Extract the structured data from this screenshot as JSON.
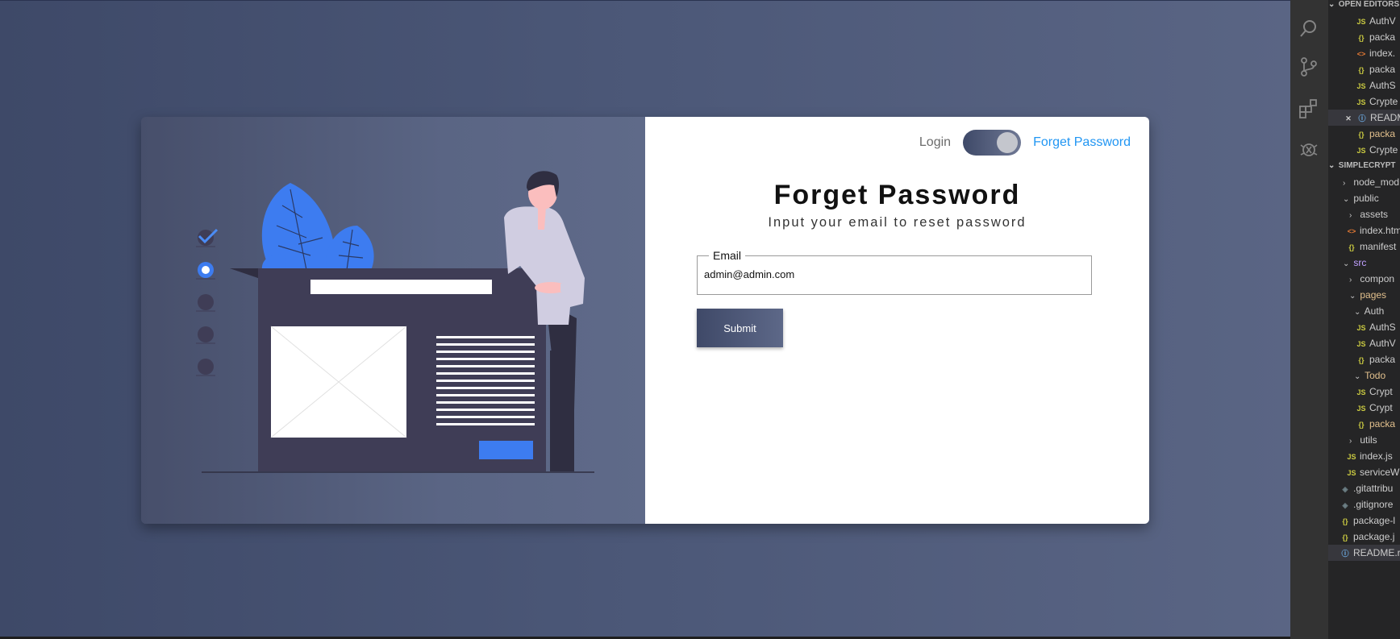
{
  "auth": {
    "toggle": {
      "left_label": "Login",
      "right_label": "Forget Password",
      "state": "forget"
    },
    "title": "Forget Password",
    "subtitle": "Input your email to reset password",
    "email": {
      "legend": "Email",
      "value": "admin@admin.com"
    },
    "submit_label": "Submit"
  },
  "colors": {
    "accent": "#2196f3",
    "illustration_blue": "#3d7cf0",
    "dark_slate": "#3f3d56",
    "page_bg": "#4c5878"
  },
  "vscode": {
    "activity_icons": [
      "search-icon",
      "source-control-icon",
      "extensions-icon",
      "debug-icon"
    ],
    "explorer": {
      "open_editors_header": "OPEN EDITORS",
      "open_editors": [
        {
          "icon": "JS",
          "name": "AuthV"
        },
        {
          "icon": "{}",
          "name": "packa"
        },
        {
          "icon": "<>",
          "name": "index."
        },
        {
          "icon": "{}",
          "name": "packa"
        },
        {
          "icon": "JS",
          "name": "AuthS"
        },
        {
          "icon": "JS",
          "name": "Crypte"
        },
        {
          "icon": "i",
          "name": "READM"
        },
        {
          "icon": "{}",
          "name": "packa"
        },
        {
          "icon": "JS",
          "name": "Crypte"
        }
      ],
      "project_header": "SIMPLECRYPT",
      "tree": [
        {
          "label": "node_mod",
          "type": "folder"
        },
        {
          "label": "public",
          "type": "folder"
        },
        {
          "label": "assets",
          "type": "folder"
        },
        {
          "label": "index.htm",
          "type": "html"
        },
        {
          "label": "manifest",
          "type": "json"
        },
        {
          "label": "src",
          "type": "folder"
        },
        {
          "label": "compon",
          "type": "folder"
        },
        {
          "label": "pages",
          "type": "folder"
        },
        {
          "label": "Auth",
          "type": "folder"
        },
        {
          "label": "AuthS",
          "type": "js"
        },
        {
          "label": "AuthV",
          "type": "js"
        },
        {
          "label": "packa",
          "type": "json"
        },
        {
          "label": "Todo",
          "type": "folder"
        },
        {
          "label": "Crypt",
          "type": "js"
        },
        {
          "label": "Crypt",
          "type": "js"
        },
        {
          "label": "packa",
          "type": "json"
        },
        {
          "label": "utils",
          "type": "folder"
        },
        {
          "label": "index.js",
          "type": "js"
        },
        {
          "label": "serviceW",
          "type": "js"
        },
        {
          "label": ".gitattribu",
          "type": "git"
        },
        {
          "label": ".gitignore",
          "type": "git"
        },
        {
          "label": "package-l",
          "type": "json"
        },
        {
          "label": "package.j",
          "type": "json"
        },
        {
          "label": "README.r",
          "type": "info"
        }
      ]
    }
  }
}
